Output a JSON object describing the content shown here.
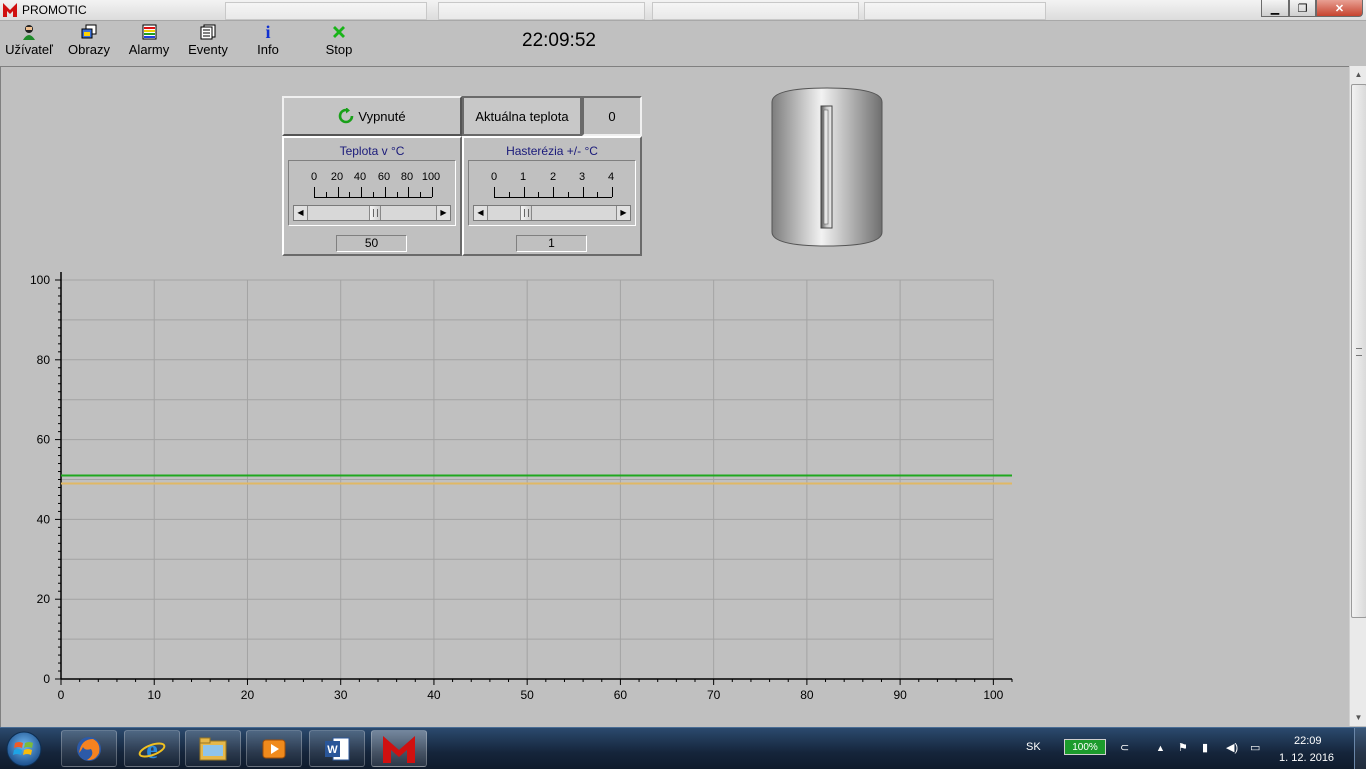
{
  "window": {
    "title": "PROMOTIC",
    "close_glyph": "✕",
    "minimize_glyph": "▁",
    "maximize_glyph": "❐"
  },
  "toolbar": {
    "items": [
      {
        "label": "Užívateľ",
        "icon": "user-icon"
      },
      {
        "label": "Obrazy",
        "icon": "screens-icon"
      },
      {
        "label": "Alarmy",
        "icon": "alarms-icon"
      },
      {
        "label": "Eventy",
        "icon": "events-icon"
      },
      {
        "label": "Info",
        "icon": "info-icon"
      },
      {
        "label": "Stop",
        "icon": "stop-icon"
      }
    ],
    "clock": "22:09:52"
  },
  "panel": {
    "state_button": "Vypnuté",
    "actual_temp_label": "Aktuálna teplota",
    "actual_temp_value": "0",
    "temperature": {
      "title": "Teplota v °C",
      "ticks": [
        "0",
        "20",
        "40",
        "60",
        "80",
        "100"
      ],
      "min": 0,
      "max": 100,
      "value": 50,
      "value_text": "50"
    },
    "hysteresis": {
      "title": "Hasterézia +/- °C",
      "ticks": [
        "0",
        "1",
        "2",
        "3",
        "4"
      ],
      "min": 0,
      "max": 4,
      "value": 1,
      "value_text": "1"
    }
  },
  "chart_data": {
    "type": "line",
    "xlim": [
      0,
      102
    ],
    "ylim": [
      0,
      100
    ],
    "x_ticks": [
      "0",
      "10",
      "20",
      "30",
      "40",
      "50",
      "60",
      "70",
      "80",
      "90",
      "100"
    ],
    "y_ticks": [
      "0",
      "20",
      "40",
      "60",
      "80",
      "100"
    ],
    "grid": true,
    "series": [
      {
        "color": "#1fa81f",
        "x": [
          0,
          102
        ],
        "y": [
          51,
          51
        ]
      },
      {
        "color": "#e0b865",
        "x": [
          0,
          102
        ],
        "y": [
          49,
          49
        ]
      }
    ]
  },
  "taskbar": {
    "apps": [
      "firefox-icon",
      "internet-explorer-icon",
      "file-explorer-icon",
      "media-player-icon",
      "word-icon",
      "promotic-icon"
    ],
    "language": "SK",
    "battery": "100%",
    "time": "22:09",
    "date": "1. 12. 2016"
  },
  "colors": {
    "workspace": "#c0c0c0",
    "title_text": "#1a1a7a",
    "grid": "#a3a3a3"
  }
}
